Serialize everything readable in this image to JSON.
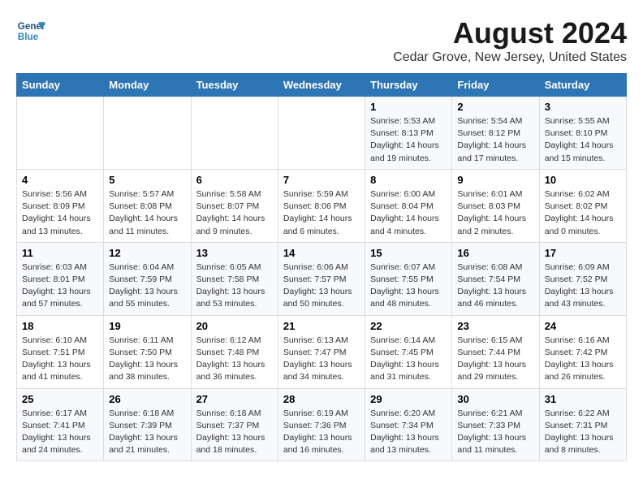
{
  "header": {
    "logo_line1": "General",
    "logo_line2": "Blue",
    "title": "August 2024",
    "subtitle": "Cedar Grove, New Jersey, United States"
  },
  "columns": [
    "Sunday",
    "Monday",
    "Tuesday",
    "Wednesday",
    "Thursday",
    "Friday",
    "Saturday"
  ],
  "weeks": [
    {
      "days": [
        {
          "num": "",
          "info": ""
        },
        {
          "num": "",
          "info": ""
        },
        {
          "num": "",
          "info": ""
        },
        {
          "num": "",
          "info": ""
        },
        {
          "num": "1",
          "info": "Sunrise: 5:53 AM\nSunset: 8:13 PM\nDaylight: 14 hours\nand 19 minutes."
        },
        {
          "num": "2",
          "info": "Sunrise: 5:54 AM\nSunset: 8:12 PM\nDaylight: 14 hours\nand 17 minutes."
        },
        {
          "num": "3",
          "info": "Sunrise: 5:55 AM\nSunset: 8:10 PM\nDaylight: 14 hours\nand 15 minutes."
        }
      ]
    },
    {
      "days": [
        {
          "num": "4",
          "info": "Sunrise: 5:56 AM\nSunset: 8:09 PM\nDaylight: 14 hours\nand 13 minutes."
        },
        {
          "num": "5",
          "info": "Sunrise: 5:57 AM\nSunset: 8:08 PM\nDaylight: 14 hours\nand 11 minutes."
        },
        {
          "num": "6",
          "info": "Sunrise: 5:58 AM\nSunset: 8:07 PM\nDaylight: 14 hours\nand 9 minutes."
        },
        {
          "num": "7",
          "info": "Sunrise: 5:59 AM\nSunset: 8:06 PM\nDaylight: 14 hours\nand 6 minutes."
        },
        {
          "num": "8",
          "info": "Sunrise: 6:00 AM\nSunset: 8:04 PM\nDaylight: 14 hours\nand 4 minutes."
        },
        {
          "num": "9",
          "info": "Sunrise: 6:01 AM\nSunset: 8:03 PM\nDaylight: 14 hours\nand 2 minutes."
        },
        {
          "num": "10",
          "info": "Sunrise: 6:02 AM\nSunset: 8:02 PM\nDaylight: 14 hours\nand 0 minutes."
        }
      ]
    },
    {
      "days": [
        {
          "num": "11",
          "info": "Sunrise: 6:03 AM\nSunset: 8:01 PM\nDaylight: 13 hours\nand 57 minutes."
        },
        {
          "num": "12",
          "info": "Sunrise: 6:04 AM\nSunset: 7:59 PM\nDaylight: 13 hours\nand 55 minutes."
        },
        {
          "num": "13",
          "info": "Sunrise: 6:05 AM\nSunset: 7:58 PM\nDaylight: 13 hours\nand 53 minutes."
        },
        {
          "num": "14",
          "info": "Sunrise: 6:06 AM\nSunset: 7:57 PM\nDaylight: 13 hours\nand 50 minutes."
        },
        {
          "num": "15",
          "info": "Sunrise: 6:07 AM\nSunset: 7:55 PM\nDaylight: 13 hours\nand 48 minutes."
        },
        {
          "num": "16",
          "info": "Sunrise: 6:08 AM\nSunset: 7:54 PM\nDaylight: 13 hours\nand 46 minutes."
        },
        {
          "num": "17",
          "info": "Sunrise: 6:09 AM\nSunset: 7:52 PM\nDaylight: 13 hours\nand 43 minutes."
        }
      ]
    },
    {
      "days": [
        {
          "num": "18",
          "info": "Sunrise: 6:10 AM\nSunset: 7:51 PM\nDaylight: 13 hours\nand 41 minutes."
        },
        {
          "num": "19",
          "info": "Sunrise: 6:11 AM\nSunset: 7:50 PM\nDaylight: 13 hours\nand 38 minutes."
        },
        {
          "num": "20",
          "info": "Sunrise: 6:12 AM\nSunset: 7:48 PM\nDaylight: 13 hours\nand 36 minutes."
        },
        {
          "num": "21",
          "info": "Sunrise: 6:13 AM\nSunset: 7:47 PM\nDaylight: 13 hours\nand 34 minutes."
        },
        {
          "num": "22",
          "info": "Sunrise: 6:14 AM\nSunset: 7:45 PM\nDaylight: 13 hours\nand 31 minutes."
        },
        {
          "num": "23",
          "info": "Sunrise: 6:15 AM\nSunset: 7:44 PM\nDaylight: 13 hours\nand 29 minutes."
        },
        {
          "num": "24",
          "info": "Sunrise: 6:16 AM\nSunset: 7:42 PM\nDaylight: 13 hours\nand 26 minutes."
        }
      ]
    },
    {
      "days": [
        {
          "num": "25",
          "info": "Sunrise: 6:17 AM\nSunset: 7:41 PM\nDaylight: 13 hours\nand 24 minutes."
        },
        {
          "num": "26",
          "info": "Sunrise: 6:18 AM\nSunset: 7:39 PM\nDaylight: 13 hours\nand 21 minutes."
        },
        {
          "num": "27",
          "info": "Sunrise: 6:18 AM\nSunset: 7:37 PM\nDaylight: 13 hours\nand 18 minutes."
        },
        {
          "num": "28",
          "info": "Sunrise: 6:19 AM\nSunset: 7:36 PM\nDaylight: 13 hours\nand 16 minutes."
        },
        {
          "num": "29",
          "info": "Sunrise: 6:20 AM\nSunset: 7:34 PM\nDaylight: 13 hours\nand 13 minutes."
        },
        {
          "num": "30",
          "info": "Sunrise: 6:21 AM\nSunset: 7:33 PM\nDaylight: 13 hours\nand 11 minutes."
        },
        {
          "num": "31",
          "info": "Sunrise: 6:22 AM\nSunset: 7:31 PM\nDaylight: 13 hours\nand 8 minutes."
        }
      ]
    }
  ]
}
